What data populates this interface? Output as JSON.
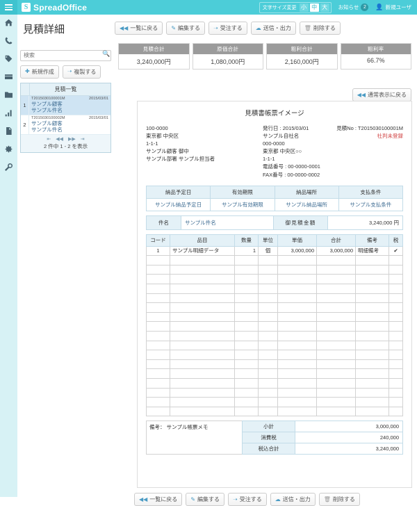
{
  "topbar": {
    "menu_icon": "hamburger-icon",
    "logo_mark": "S",
    "logo_text": "SpreadOffice",
    "fontsize_label": "文字サイズ変更",
    "fontsize_options": [
      "小",
      "中",
      "大"
    ],
    "fontsize_selected": "中",
    "notice_label": "お知らせ",
    "notice_count": "2",
    "user_label": "新規ユーザ",
    "accent_color": "#4ccdd8"
  },
  "rail": {
    "items": [
      {
        "icon": "home-icon"
      },
      {
        "icon": "phone-icon"
      },
      {
        "icon": "tag-icon"
      },
      {
        "icon": "card-icon"
      },
      {
        "icon": "folder-icon"
      },
      {
        "icon": "chart-icon"
      },
      {
        "icon": "document-icon"
      },
      {
        "icon": "gear-icon"
      },
      {
        "icon": "wrench-icon"
      }
    ]
  },
  "page": {
    "title": "見積詳細"
  },
  "toolbar": {
    "back_label": "一覧に戻る",
    "edit_label": "編集する",
    "order_label": "受注する",
    "send_label": "送信・出力",
    "delete_label": "削除する",
    "back_normal_label": "通常表示に戻る"
  },
  "summary": {
    "cells": [
      {
        "head": "見積合計",
        "value": "3,240,000円"
      },
      {
        "head": "原価合計",
        "value": "1,080,000円"
      },
      {
        "head": "粗利合計",
        "value": "2,160,000円"
      },
      {
        "head": "粗利率",
        "value": "66.7%"
      }
    ]
  },
  "listpanel": {
    "search_placeholder": "検索",
    "search_value": "",
    "new_label": "新規作成",
    "copy_label": "複製する",
    "list_header": "見積一覧",
    "rows": [
      {
        "num": "1",
        "id": "T2015030100001M",
        "date": "2015/03/01",
        "customer": "サンプル顧客",
        "subject": "サンプル件名"
      },
      {
        "num": "2",
        "id": "T2015030100002M",
        "date": "2015/03/01",
        "customer": "サンプル顧客",
        "subject": "サンプル件名"
      }
    ],
    "pager_text": "2 件中 1 - 2 を表示",
    "pager_icons": [
      "first-page-icon",
      "prev-page-icon",
      "next-page-icon",
      "last-page-icon"
    ]
  },
  "document": {
    "title": "見積書帳票イメージ",
    "customer": {
      "postal": "100-0000",
      "address1": "東京都 中央区",
      "address2": "1-1-1",
      "name": "サンプル顧客 御中",
      "contact": "サンプル部署 サンプル担当者"
    },
    "issuer": {
      "issue_date": "発行日 : 2015/03/01",
      "quote_no": "見積No : T2015030100001M",
      "seal_status": "社判未登録",
      "company": "サンプル自社名",
      "postal": "000-0000",
      "address1": "東京都 中央区○○",
      "address2": "1-1-1",
      "tel": "電話番号 : 00-0000-0001",
      "fax": "FAX番号 : 00-0000-0002"
    },
    "conditions": {
      "headers": [
        "納品予定日",
        "有効期限",
        "納品場所",
        "支払条件"
      ],
      "values": [
        "サンプル納品予定日",
        "サンプル有効期限",
        "サンプル納品場所",
        "サンプル支払条件"
      ]
    },
    "subject_row": {
      "label": "件名",
      "value": "サンプル件名",
      "amount_label": "御見積金額",
      "amount_value": "3,240,000 円"
    },
    "items": {
      "headers": [
        "コード",
        "品目",
        "数量",
        "単位",
        "単価",
        "合計",
        "備考",
        "税"
      ],
      "rows": [
        {
          "code": "1",
          "name": "サンプル明細データ",
          "qty": "1",
          "unit": "個",
          "price": "3,000,000",
          "total": "3,000,000",
          "note": "明細備考",
          "tax": "✔"
        }
      ],
      "empty_row_count": 17
    },
    "memo": "備考： サンプル帳票メモ",
    "totals": [
      {
        "label": "小計",
        "value": "3,000,000"
      },
      {
        "label": "消費税",
        "value": "240,000"
      },
      {
        "label": "税込合計",
        "value": "3,240,000"
      }
    ]
  }
}
